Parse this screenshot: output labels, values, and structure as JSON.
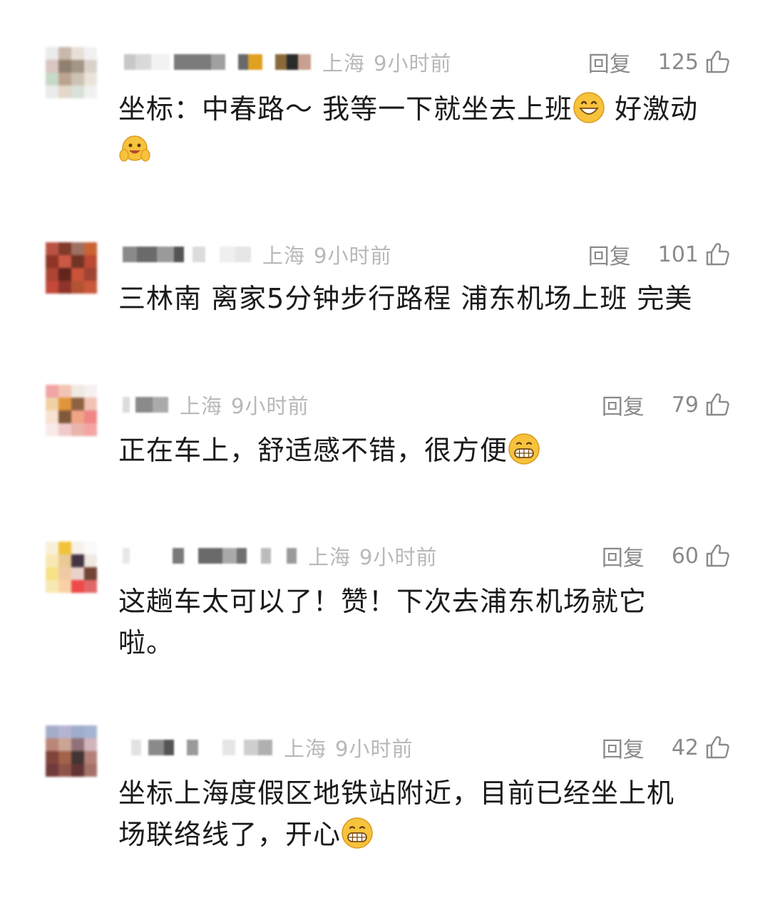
{
  "comments": [
    {
      "location": "上海",
      "time": "9小时前",
      "reply_label": "回复",
      "likes": "125",
      "text_segments": [
        "坐标：中春路～ 我等一下就坐去上班",
        " 好激动"
      ],
      "emojis": [
        "grinning-emoji",
        "hands-up-emoji"
      ]
    },
    {
      "location": "上海",
      "time": "9小时前",
      "reply_label": "回复",
      "likes": "101",
      "text": "三林南 离家5分钟步行路程 浦东机场上班 完美"
    },
    {
      "location": "上海",
      "time": "9小时前",
      "reply_label": "回复",
      "likes": "79",
      "text": "正在车上，舒适感不错，很方便",
      "emojis": [
        "grimacing-emoji"
      ]
    },
    {
      "location": "上海",
      "time": "9小时前",
      "reply_label": "回复",
      "likes": "60",
      "text_lines": [
        "这趟车太可以了！赞！下次去浦东机场就它",
        "啦。"
      ]
    },
    {
      "location": "上海",
      "time": "9小时前",
      "reply_label": "回复",
      "likes": "42",
      "text_lines": [
        "坐标上海度假区地铁站附近，目前已经坐上机",
        "场联络线了，开心"
      ],
      "emojis": [
        "grimacing-emoji"
      ]
    }
  ],
  "colors": {
    "meta_gray": "#b8b8b8",
    "action_gray": "#8a8a8a",
    "text": "#1a1a1a",
    "emoji_yellow": "#f7c23c"
  }
}
